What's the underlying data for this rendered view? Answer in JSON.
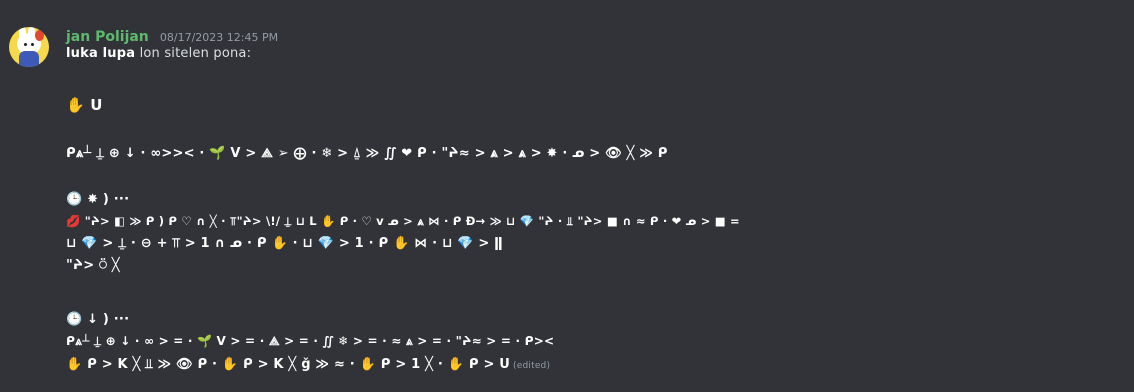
{
  "message": {
    "username": "jan Polijan",
    "timestamp": "08/17/2023 12:45 PM",
    "intro_name": "luka lupa",
    "intro_rest": "lon sitelen pona:",
    "edited_label": "(edited)",
    "lines": [
      "✋ U",
      "ᑭ⩓┴ ⍊ ⊕ ↓ · ∞>>< · 🌱 V > ⟁ ➢ ⨁ · ❄ > ⍙ ≫ ∬ ❤ ᑭ · \"ᔨ≈ > ⩓ > ⩓ > ✸ · ᓄ > 👁 ╳ ≫ ᑭ",
      "🕒 ✸ ) ···",
      "💋 \"ᔨ> ◧ ≫ ᑭ ) ᑭ ♡ ∩ ╳ · ⫪\"ᔨ> \\!/ ⍊ ⊔ L ✋ ᑭ · ♡ v ᓄ > ⩓ ⋈ · ᑭ Ð→ ≫ ⊔ 💎 \"ᔨ · ⫫ \"ᔨ> ■ ∩ ≈ ᑭ · ❤ ᓄ > ■ =",
      "⊔ 💎 > ⍊ · ⊖ + ⫪ > 1 ∩ ᓄ · ᑭ ✋ · ⊔ 💎 > 1 · ᑭ ✋ ⋈ · ⊔ 💎 > ǁ",
      "\"ᔨ> ⍥ ╳",
      "🕒 ↓ ) ···",
      "ᑭ⩓┴ ⍊ ⊕ ↓ · ∞ > = · 🌱 V > = · ⟁ > = · ∬ ❄ > = · ≈ ⩓ > = · \"ᔨ≈ > = · ᑭ><",
      "✋ ᑭ > K ╳ ⫫ ≫ 👁 ᑭ · ✋ ᑭ > K ╳ ǧ ≫ ≈ · ✋ ᑭ > 1 ╳ · ✋ ᑭ > U"
    ]
  },
  "colors": {
    "background": "#313338",
    "username": "#5fb96c",
    "timestamp": "#949ba4",
    "text": "#dbdee1",
    "bold": "#ffffff"
  }
}
